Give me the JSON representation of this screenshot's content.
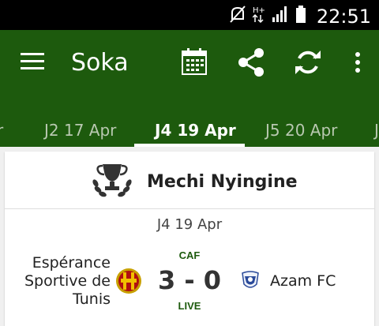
{
  "status_bar": {
    "time": "22:51",
    "icons": [
      "mute-icon",
      "network-icon",
      "signal-icon",
      "battery-icon"
    ]
  },
  "app_bar": {
    "title": "Soka",
    "actions": [
      "calendar-icon",
      "share-icon",
      "refresh-icon",
      "more-icon"
    ],
    "color": "#1d5a0d"
  },
  "tabs": [
    {
      "label": "r"
    },
    {
      "label": "J2 17 Apr"
    },
    {
      "label": "J4 19 Apr",
      "active": true
    },
    {
      "label": "J5 20 Apr"
    },
    {
      "label": "J"
    }
  ],
  "league": {
    "name": "Mechi Nyingine",
    "icon": "trophy-icon"
  },
  "match": {
    "date": "J4 19 Apr",
    "competition": "CAF",
    "home_team": "Espérance Sportive de Tunis",
    "home_line1": "Espérance",
    "home_line2": "Sportive de",
    "home_line3": "Tunis",
    "away_team": "Azam FC",
    "score": "3 - 0",
    "status": "LIVE"
  }
}
